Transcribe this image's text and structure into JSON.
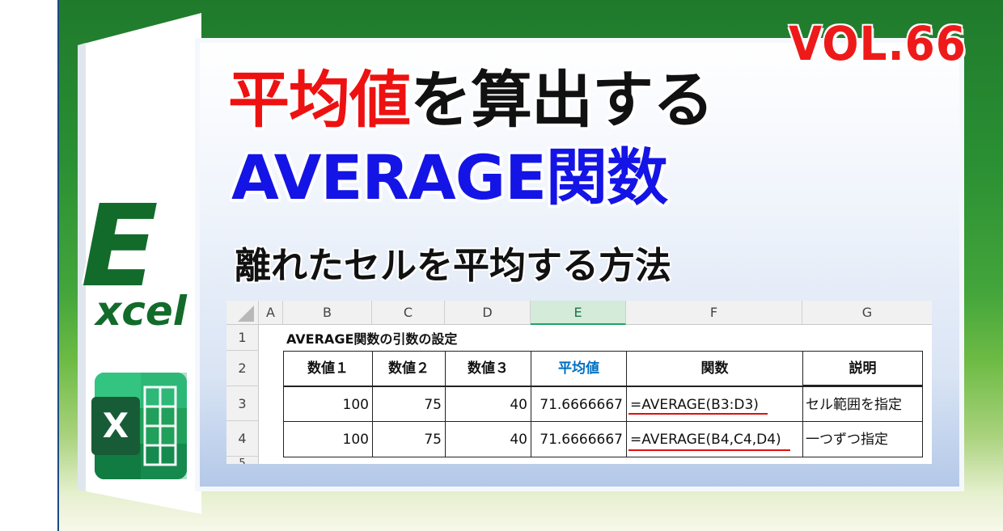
{
  "vol": "VOL.66",
  "title": {
    "part_red": "平均値",
    "part_black": "を算出する",
    "line2": "AVERAGE関数"
  },
  "subtitle": "離れたセルを平均する方法",
  "logo": {
    "big_letter": "E",
    "rest": "xcel",
    "icon_letter": "X"
  },
  "colors": {
    "green_bg": "#1f7a2c",
    "title_red": "#ee1111",
    "title_blue": "#1414e6",
    "excel_green": "#107c41"
  },
  "sheet": {
    "columns": [
      "A",
      "B",
      "C",
      "D",
      "E",
      "F",
      "G"
    ],
    "selected_column": "E",
    "rows": [
      "1",
      "2",
      "3",
      "4",
      "5"
    ],
    "caption": "AVERAGE関数の引数の設定",
    "headers": [
      "数値１",
      "数値２",
      "数値３",
      "平均値",
      "関数",
      "説明"
    ],
    "data": [
      [
        "100",
        "75",
        "40",
        "71.6666667",
        "=AVERAGE(B3:D3)",
        "セル範囲を指定"
      ],
      [
        "100",
        "75",
        "40",
        "71.6666667",
        "=AVERAGE(B4,C4,D4)",
        "一つずつ指定"
      ]
    ]
  }
}
